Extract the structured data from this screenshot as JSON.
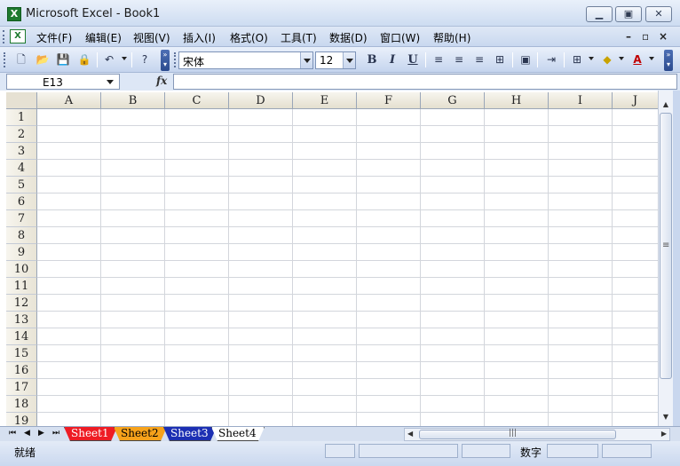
{
  "window": {
    "title": "Microsoft Excel - Book1"
  },
  "menu": {
    "items": [
      "文件(F)",
      "编辑(E)",
      "视图(V)",
      "插入(I)",
      "格式(O)",
      "工具(T)",
      "数据(D)",
      "窗口(W)",
      "帮助(H)"
    ]
  },
  "toolbar": {
    "font_name": "宋体",
    "font_size": "12",
    "bold": "B",
    "italic": "I",
    "underline": "U"
  },
  "formula_bar": {
    "name_box": "E13",
    "fx_label": "fx",
    "formula": ""
  },
  "sheet": {
    "columns": [
      "A",
      "B",
      "C",
      "D",
      "E",
      "F",
      "G",
      "H",
      "I",
      "J"
    ],
    "rows": [
      "1",
      "2",
      "3",
      "4",
      "5",
      "6",
      "7",
      "8",
      "9",
      "10",
      "11",
      "12",
      "13",
      "14",
      "15",
      "16",
      "17",
      "18",
      "19"
    ]
  },
  "tabs": [
    "Sheet1",
    "Sheet2",
    "Sheet3",
    "Sheet4"
  ],
  "status": {
    "ready": "就绪",
    "mode": "数字"
  }
}
